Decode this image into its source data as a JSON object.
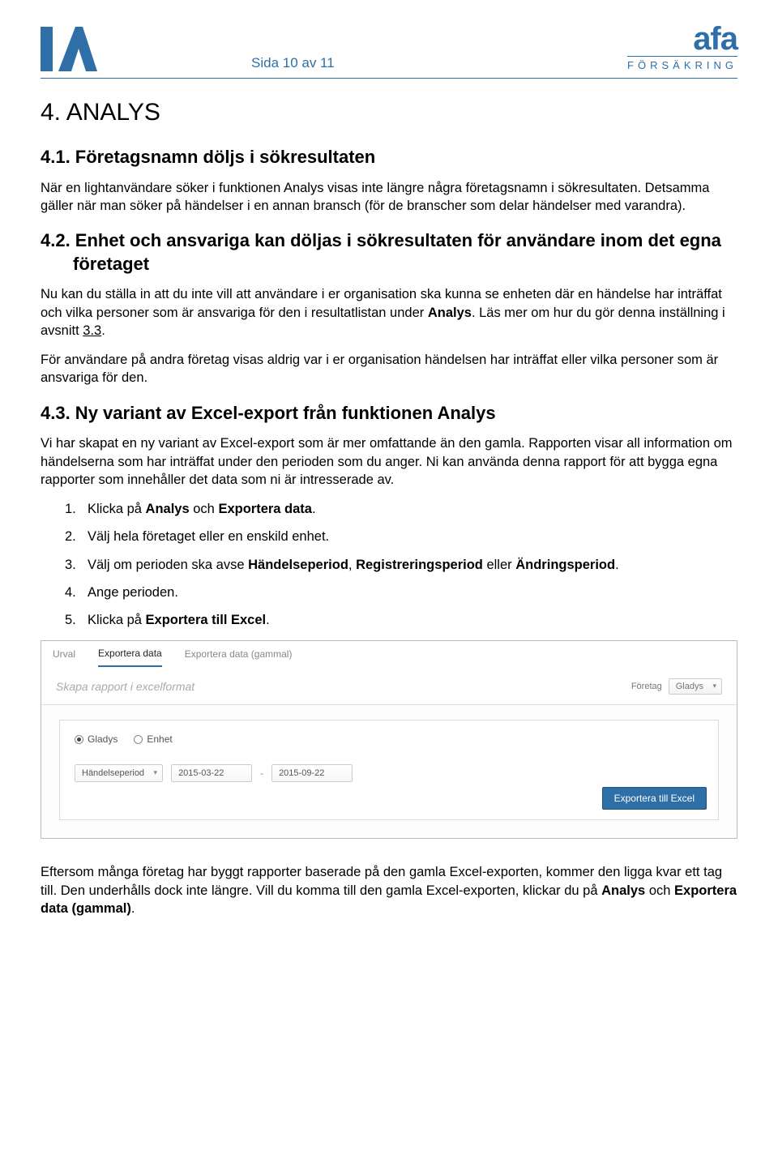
{
  "header": {
    "page_label": "Sida 10 av 11",
    "afa_main": "afa",
    "afa_sub": "FÖRSÄKRING"
  },
  "h1": "4. ANALYS",
  "sec41": {
    "title": "4.1. Företagsnamn döljs i sökresultaten",
    "p1": "När en lightanvändare söker i funktionen Analys visas inte längre några företagsnamn i sökresultaten. Detsamma gäller när man söker på händelser i en annan bransch (för de branscher som delar händelser med varandra)."
  },
  "sec42": {
    "title": "4.2. Enhet och ansvariga kan döljas i sökresultaten för användare inom det egna företaget",
    "p1_a": "Nu kan du ställa in att du inte vill att användare i er organisation ska kunna se enheten där en händelse har inträffat och vilka personer som är ansvariga för den i resultatlistan under ",
    "p1_b": "Analys",
    "p1_c": ". Läs mer om hur du gör denna inställning i avsnitt ",
    "p1_link": "3.3",
    "p1_d": ".",
    "p2": "För användare på andra företag visas aldrig var i er organisation händelsen har inträffat eller vilka personer som är ansvariga för den."
  },
  "sec43": {
    "title": "4.3. Ny variant av Excel-export från funktionen Analys",
    "p1": "Vi har skapat en ny variant av Excel-export som är mer omfattande än den gamla. Rapporten visar all information om händelserna som har inträffat under den perioden som du anger. Ni kan använda denna rapport för att bygga egna rapporter som innehåller det data som ni är intresserade av.",
    "list": [
      {
        "n": "1.",
        "a": "Klicka på ",
        "b": "Analys",
        "c": " och ",
        "d": "Exportera data",
        "e": "."
      },
      {
        "n": "2.",
        "a": "Välj hela företaget eller en enskild enhet."
      },
      {
        "n": "3.",
        "a": "Välj om perioden ska avse ",
        "b": "Händelseperiod",
        "c": ", ",
        "d": "Registreringsperiod",
        "e": " eller ",
        "f": "Ändringsperiod",
        "g": "."
      },
      {
        "n": "4.",
        "a": "Ange perioden."
      },
      {
        "n": "5.",
        "a": "Klicka på ",
        "b": "Exportera till Excel",
        "c": "."
      }
    ]
  },
  "screenshot": {
    "tabs": {
      "t1": "Urval",
      "t2": "Exportera data",
      "t3": "Exportera data (gammal)"
    },
    "subtitle": "Skapa rapport i excelformat",
    "company_label": "Företag",
    "company_value": "Gladys",
    "radio1": "Gladys",
    "radio2": "Enhet",
    "period_type": "Händelseperiod",
    "date1": "2015-03-22",
    "date2": "2015-09-22",
    "button": "Exportera till Excel"
  },
  "footer_p_a": "Eftersom många företag har byggt rapporter baserade på den gamla Excel-exporten, kommer den ligga kvar ett tag till. Den underhålls dock inte längre. Vill du komma till den gamla Excel-exporten, klickar du på ",
  "footer_p_b": "Analys",
  "footer_p_c": " och ",
  "footer_p_d": "Exportera data (gammal)",
  "footer_p_e": "."
}
